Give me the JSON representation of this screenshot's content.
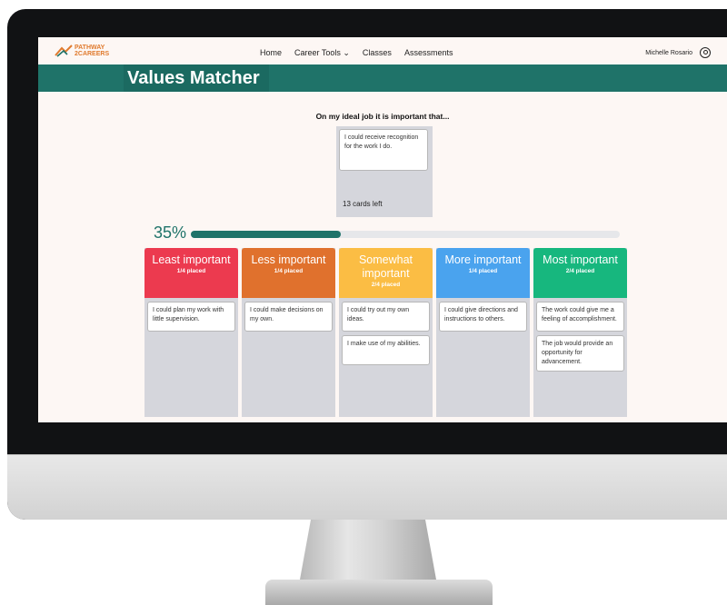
{
  "app": {
    "brand_line1": "PATHWAY",
    "brand_line2": "2CAREERS"
  },
  "nav": {
    "items": [
      {
        "label": "Home"
      },
      {
        "label": "Career Tools ⌄"
      },
      {
        "label": "Classes"
      },
      {
        "label": "Assessments"
      }
    ]
  },
  "user": {
    "name": "Michelle Rosario",
    "icon": "user-circle-icon"
  },
  "page": {
    "title": "Values Matcher"
  },
  "prompt": {
    "text": "On my ideal job it is important that..."
  },
  "deck": {
    "current_card": "I could receive recognition for the work I do.",
    "remaining": "13 cards left"
  },
  "progress": {
    "label": "35%",
    "value": 0.35
  },
  "colors": {
    "brand": "#1f7369",
    "least": "#ec3a4f",
    "less": "#e0712d",
    "somewhat": "#fbbd44",
    "more": "#4aa3ee",
    "most": "#17b77e"
  },
  "columns": [
    {
      "title": "Least important",
      "placed": "1/4 placed",
      "color": "#ec3a4f",
      "cards": [
        "I could plan my work with little supervision."
      ]
    },
    {
      "title": "Less important",
      "placed": "1/4 placed",
      "color": "#e0712d",
      "cards": [
        "I could make decisions on my own."
      ]
    },
    {
      "title": "Somewhat important",
      "placed": "2/4 placed",
      "color": "#fbbd44",
      "cards": [
        "I could try out my own ideas.",
        "I make use of my abilities."
      ]
    },
    {
      "title": "More important",
      "placed": "1/4 placed",
      "color": "#4aa3ee",
      "cards": [
        "I could give directions and instructions to others."
      ]
    },
    {
      "title": "Most important",
      "placed": "2/4 placed",
      "color": "#17b77e",
      "cards": [
        "The work could give me a feeling of accomplishment.",
        "The job would provide an opportunity for advancement."
      ]
    }
  ]
}
